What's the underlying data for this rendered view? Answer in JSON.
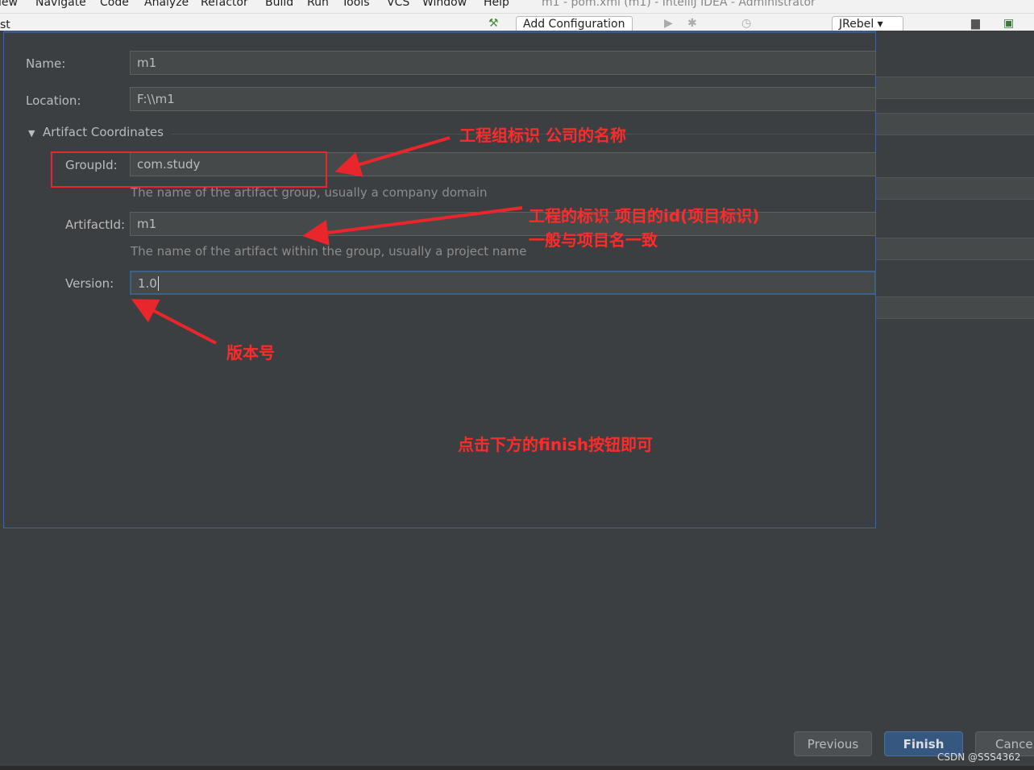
{
  "menubar": {
    "items": [
      "iew",
      "Navigate",
      "Code",
      "Analyze",
      "Refactor",
      "Build",
      "Run",
      "Tools",
      "VCS",
      "Window",
      "Help"
    ],
    "title": "m1 - pom.xml (m1) - IntelliJ IDEA - Administrator"
  },
  "toolbar": {
    "left_text": "st",
    "add_config": "Add Configuration",
    "jrebel": "JRebel"
  },
  "form": {
    "name_label": "Name:",
    "name_value": "m1",
    "location_label": "Location:",
    "location_value": "F:\\\\m1",
    "section": "Artifact Coordinates",
    "groupid_label": "GroupId:",
    "groupid_value": "com.study",
    "groupid_hint": "The name of the artifact group, usually a company domain",
    "artifactid_label": "ArtifactId:",
    "artifactid_value": "m1",
    "artifactid_hint": "The name of the artifact within the group, usually a project name",
    "version_label": "Version:",
    "version_value": "1.0"
  },
  "annotations": {
    "group": "工程组标识 公司的名称",
    "artifact_line1": "工程的标识 项目的id(项目标识)",
    "artifact_line2": "一般与项目名一致",
    "version": "版本号",
    "finish": "点击下方的finish按钮即可"
  },
  "buttons": {
    "previous": "Previous",
    "finish": "Finish",
    "cancel": "Cancel"
  },
  "watermark": "CSDN @SSS4362",
  "colors": {
    "annotation": "#e8262b",
    "primary_button": "#365880"
  }
}
